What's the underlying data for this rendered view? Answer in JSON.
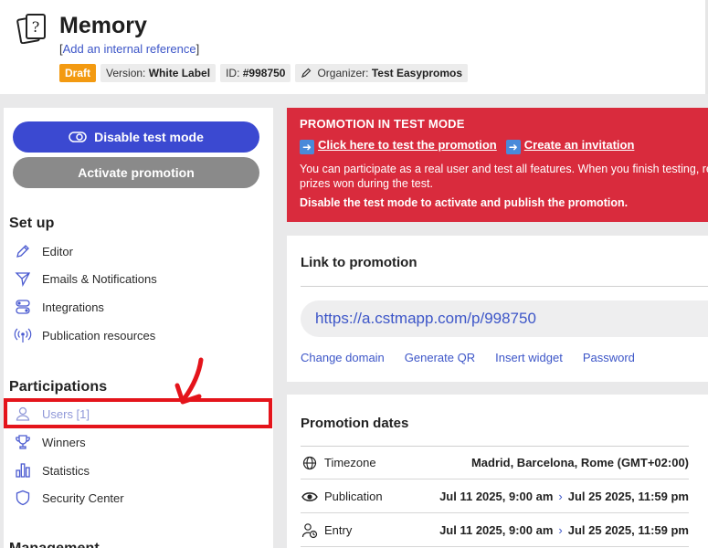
{
  "header": {
    "title": "Memory",
    "reference_open": "[",
    "reference_link": "Add an internal reference",
    "reference_close": "]",
    "badges": {
      "draft": "Draft",
      "version_label": "Version:",
      "version_value": "White Label",
      "id_label": "ID:",
      "id_value": "#998750",
      "organizer_label": "Organizer:",
      "organizer_value": "Test Easypromos"
    }
  },
  "sidebar": {
    "disable_test_mode": "Disable test mode",
    "activate_promotion": "Activate promotion",
    "setup_title": "Set up",
    "setup_items": [
      "Editor",
      "Emails & Notifications",
      "Integrations",
      "Publication resources"
    ],
    "participations_title": "Participations",
    "participation_items": [
      "Users [1]",
      "Winners",
      "Statistics",
      "Security Center"
    ],
    "next_section_title": "Management"
  },
  "alert": {
    "heading": "PROMOTION IN TEST MODE",
    "link_test": "Click here to test the promotion",
    "link_invite": "Create an invitation",
    "body_line1": "You can participate as a real user and test all features. When you finish testing, remember to delete the",
    "body_line2": "prizes won during the test.",
    "footer": "Disable the test mode to activate and publish the promotion."
  },
  "link_card": {
    "title": "Link to promotion",
    "url": "https://a.cstmapp.com/p/998750",
    "actions": [
      "Change domain",
      "Generate QR",
      "Insert widget",
      "Password"
    ]
  },
  "dates_card": {
    "title": "Promotion dates",
    "timezone_label": "Timezone",
    "timezone_value": "Madrid, Barcelona, Rome (GMT+02:00)",
    "publication_label": "Publication",
    "publication_start": "Jul 11 2025, 9:00 am",
    "publication_end": "Jul 25 2025, 11:59 pm",
    "entry_label": "Entry",
    "entry_start": "Jul 11 2025, 9:00 am",
    "entry_end": "Jul 25 2025, 11:59 pm"
  },
  "colors": {
    "accent": "#3b49d1",
    "alert": "#d92b3d",
    "draft": "#f39a11",
    "highlight": "#e4141b",
    "link": "#3d56c8"
  },
  "icons": {
    "app": "question-cards-icon",
    "editor": "pencil-icon",
    "emails": "paper-plane-icon",
    "integrations": "toggles-icon",
    "publication": "broadcast-icon",
    "users": "user-icon",
    "winners": "trophy-icon",
    "statistics": "bar-chart-icon",
    "security": "shield-icon",
    "timezone": "globe-icon",
    "publication_date": "eye-icon",
    "entry": "user-clock-icon"
  }
}
